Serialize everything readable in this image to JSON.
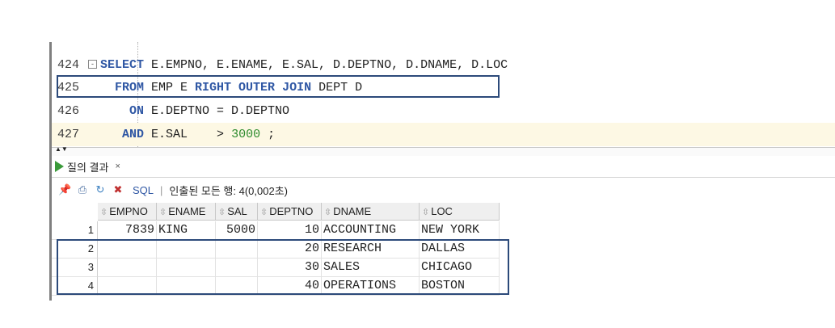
{
  "editor": {
    "lines": [
      {
        "num": "424",
        "fold": "⊟",
        "tokens": [
          {
            "t": "kw",
            "v": "SELECT"
          },
          {
            "t": "tx",
            "v": " E.EMPNO, E.ENAME, E.SAL, D.DEPTNO, D.DNAME, D.LOC"
          }
        ]
      },
      {
        "num": "425",
        "tokens": [
          {
            "t": "tx",
            "v": "  "
          },
          {
            "t": "kw",
            "v": "FROM"
          },
          {
            "t": "tx",
            "v": " EMP E "
          },
          {
            "t": "kw",
            "v": "RIGHT OUTER JOIN"
          },
          {
            "t": "tx",
            "v": " DEPT D"
          }
        ]
      },
      {
        "num": "426",
        "tokens": [
          {
            "t": "tx",
            "v": "    "
          },
          {
            "t": "kw",
            "v": "ON"
          },
          {
            "t": "tx",
            "v": " E.DEPTNO = D.DEPTNO"
          }
        ]
      },
      {
        "num": "427",
        "tokens": [
          {
            "t": "tx",
            "v": "   "
          },
          {
            "t": "kw",
            "v": "AND"
          },
          {
            "t": "tx",
            "v": " E.SAL    > "
          },
          {
            "t": "num",
            "v": "3000"
          },
          {
            "t": "tx",
            "v": " ;"
          }
        ]
      }
    ]
  },
  "results": {
    "tab_label": "질의 결과",
    "tab_close": "×",
    "toolbar": {
      "sql_label": "SQL",
      "separator": "|",
      "status": "인출된 모든 행: 4(0,002초)"
    },
    "columns": [
      "EMPNO",
      "ENAME",
      "SAL",
      "DEPTNO",
      "DNAME",
      "LOC"
    ],
    "rows": [
      {
        "num": "1",
        "cells": [
          "7839",
          "KING",
          "5000",
          "10",
          "ACCOUNTING",
          "NEW YORK"
        ]
      },
      {
        "num": "2",
        "cells": [
          "",
          "",
          "",
          "20",
          "RESEARCH",
          "DALLAS"
        ]
      },
      {
        "num": "3",
        "cells": [
          "",
          "",
          "",
          "30",
          "SALES",
          "CHICAGO"
        ]
      },
      {
        "num": "4",
        "cells": [
          "",
          "",
          "",
          "40",
          "OPERATIONS",
          "BOSTON"
        ]
      }
    ]
  },
  "icons": {
    "pin": "pin-icon",
    "print": "print-icon",
    "refresh": "refresh-icon",
    "clear": "clear-icon",
    "run": "run-icon"
  },
  "colors": {
    "keyword": "#2f57a4",
    "number": "#2e8b2e",
    "highlight_box": "#2c4a7a",
    "current_line": "#fdf8e4"
  }
}
